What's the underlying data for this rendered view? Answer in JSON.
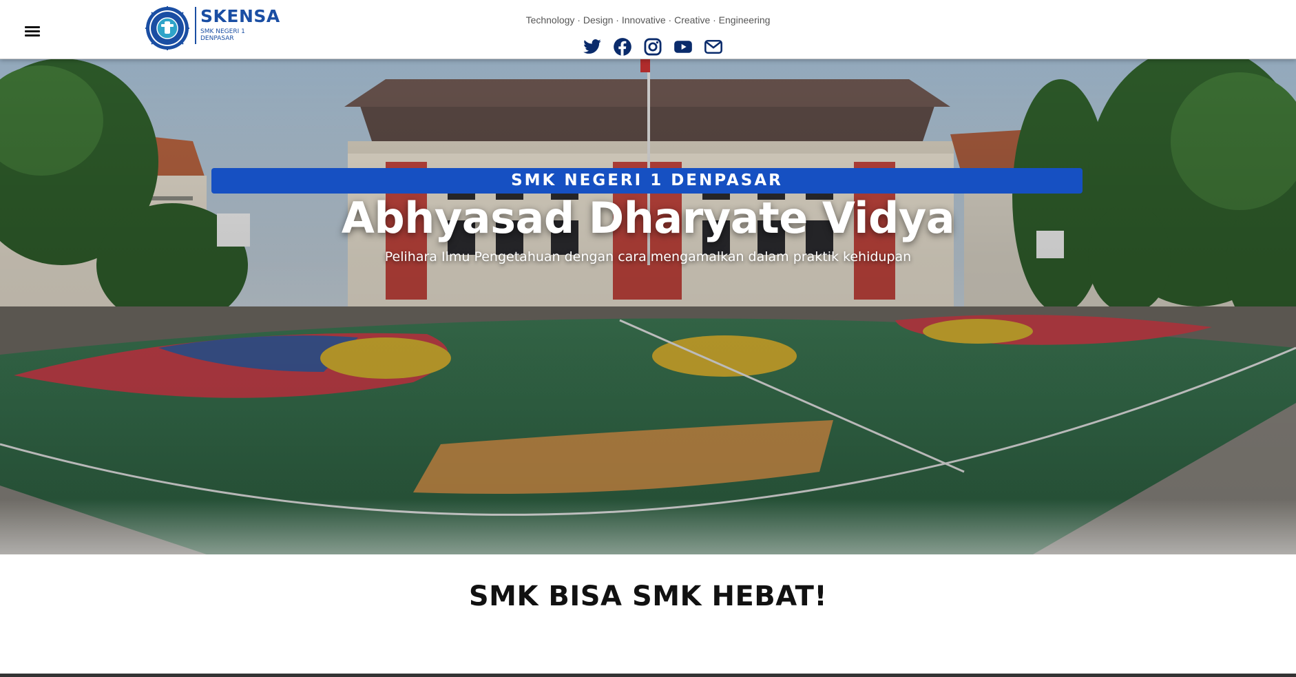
{
  "header": {
    "menu_icon": "hamburger-icon",
    "logo": {
      "name": "SKENSA",
      "sub_line1": "SMK NEGERI 1",
      "sub_line2": "DENPASAR",
      "brand_color": "#1a4ea3"
    },
    "tagline": "Technology · Design · Innovative · Creative · Engineering",
    "socials": [
      {
        "icon": "twitter-icon"
      },
      {
        "icon": "facebook-icon"
      },
      {
        "icon": "instagram-icon"
      },
      {
        "icon": "youtube-icon"
      },
      {
        "icon": "mail-icon"
      }
    ]
  },
  "hero": {
    "banner": "SMK NEGERI 1 DENPASAR",
    "banner_color": "#1650c2",
    "title": "Abhyasad Dharyate Vidya",
    "subtitle": "Pelihara Ilmu Pengetahuan dengan cara mengamalkan dalam praktik kehidupan"
  },
  "slogan": "SMK BISA SMK HEBAT!"
}
